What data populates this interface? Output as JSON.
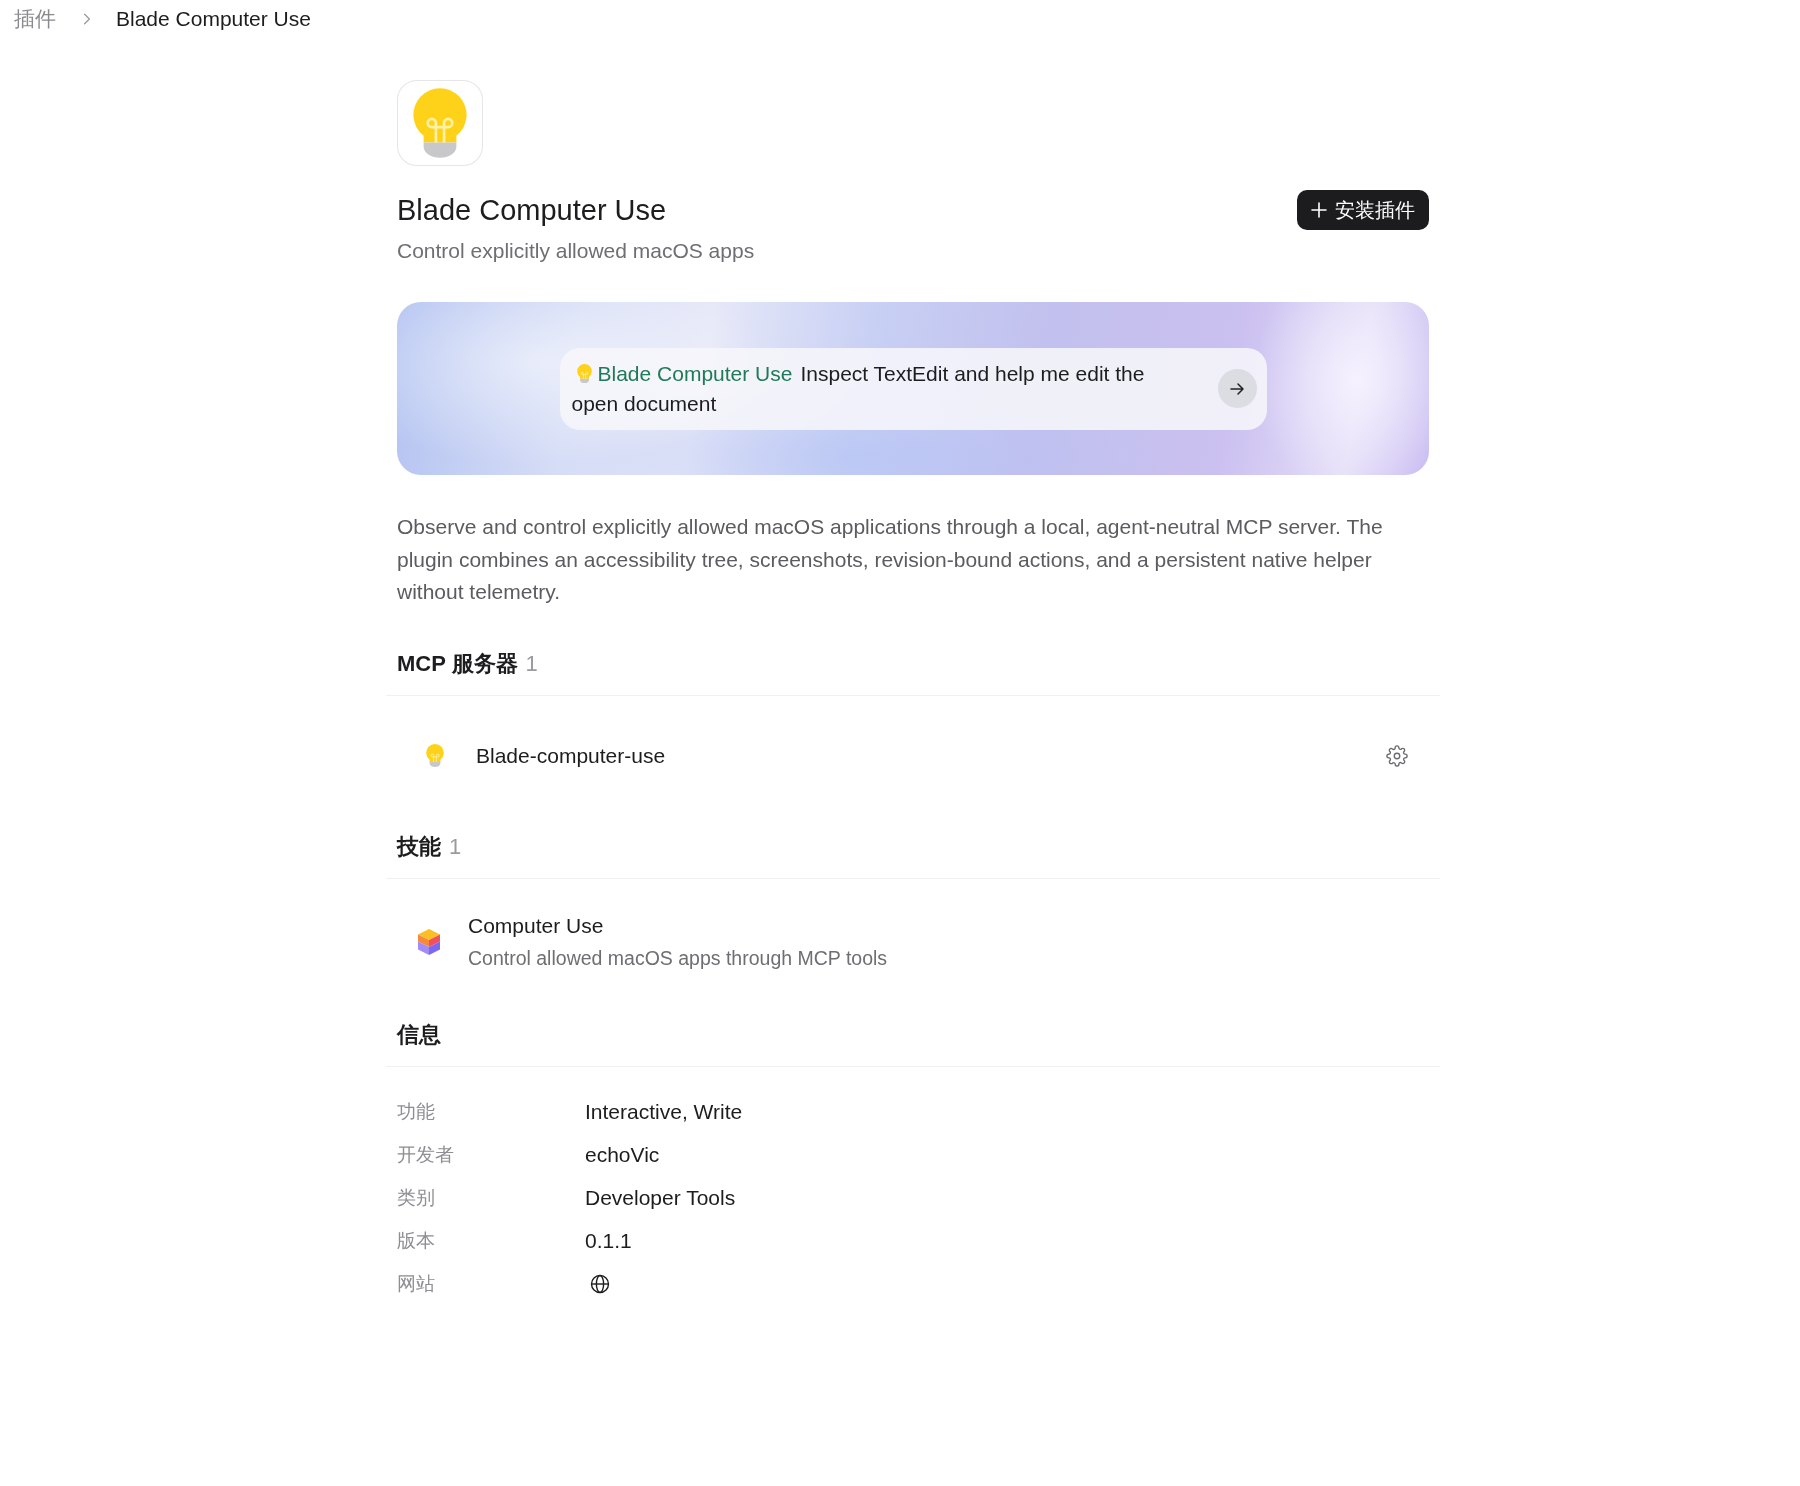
{
  "breadcrumb": [
    {
      "label": "插件",
      "current": false
    },
    {
      "label": "Blade Computer Use",
      "current": true
    }
  ],
  "plugin": {
    "title": "Blade Computer Use",
    "subtitle": "Control explicitly allowed macOS apps",
    "install_button": "安装插件"
  },
  "banner": {
    "prompt": {
      "plugin": "Blade Computer Use",
      "lines": [
        "Inspect TextEdit and help me edit the",
        "open document"
      ]
    }
  },
  "description": "Observe and control explicitly allowed macOS applications through a local, agent-neutral MCP server. The plugin combines an accessibility tree, screenshots, revision-bound actions, and a persistent native helper without telemetry.",
  "sections": [
    {
      "kind": "servers",
      "title": "MCP 服务器",
      "count": "1",
      "items": [
        {
          "name": "Blade-computer-use"
        }
      ]
    },
    {
      "kind": "skills",
      "title": "技能",
      "count": "1",
      "items": [
        {
          "name": "Computer Use",
          "description": "Control allowed macOS apps through MCP tools"
        }
      ]
    },
    {
      "kind": "info",
      "title": "信息",
      "rows": [
        {
          "kind": "text",
          "label": "功能",
          "value": "Interactive, Write"
        },
        {
          "kind": "text",
          "label": "开发者",
          "value": "echoVic"
        },
        {
          "kind": "text",
          "label": "类别",
          "value": "Developer Tools"
        },
        {
          "kind": "text",
          "label": "版本",
          "value": "0.1.1"
        },
        {
          "kind": "globe",
          "label": "网站"
        }
      ]
    }
  ]
}
